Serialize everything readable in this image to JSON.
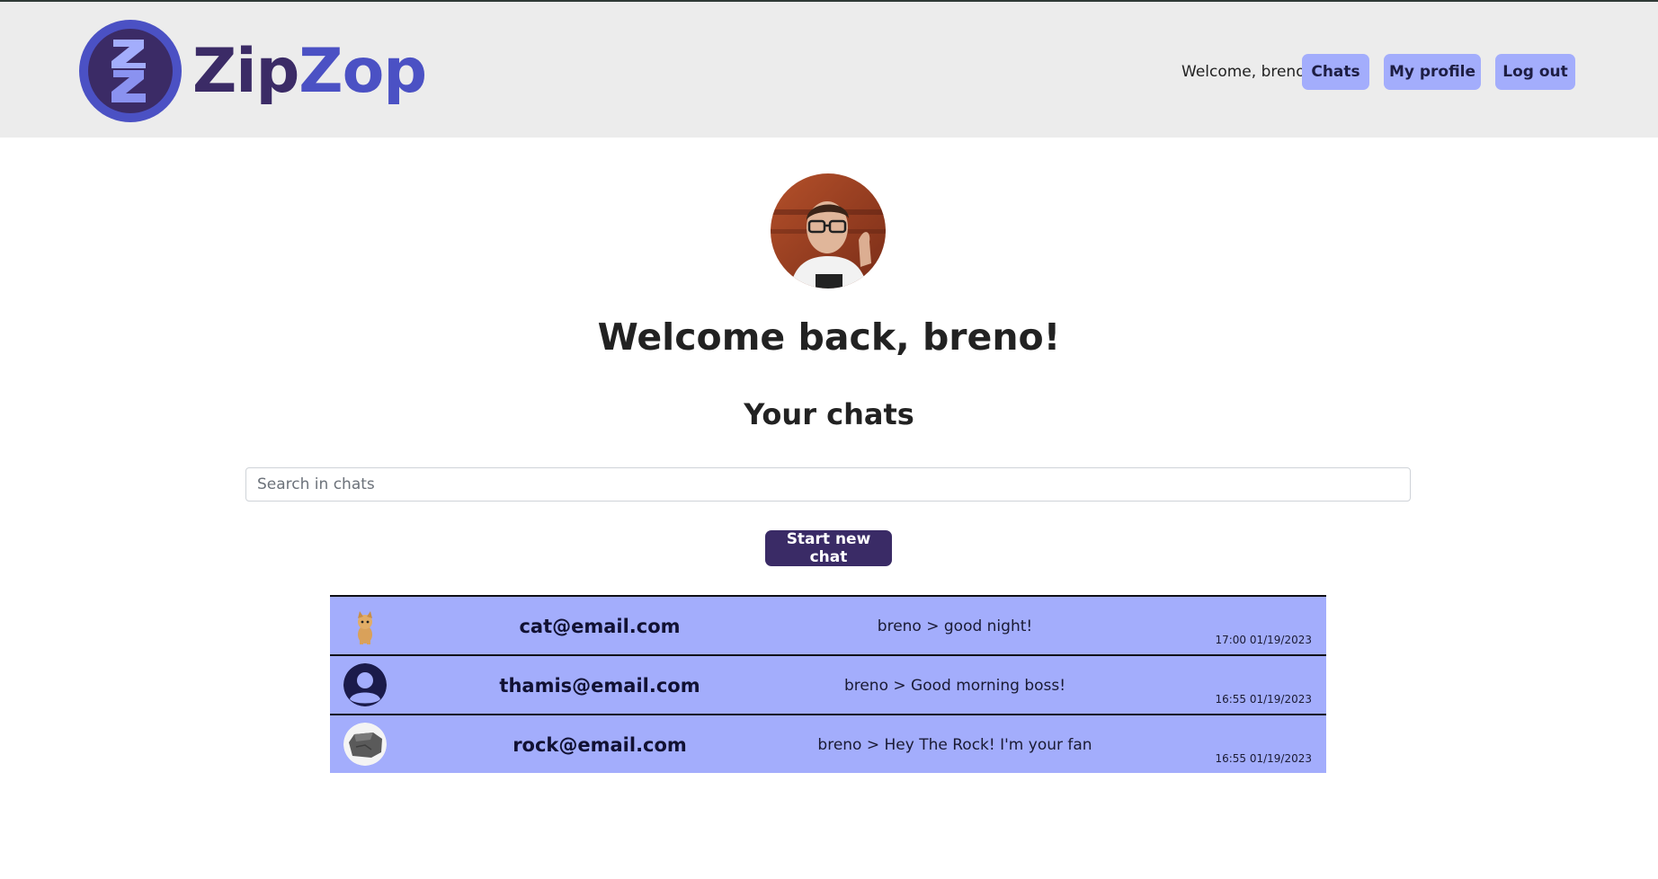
{
  "header": {
    "brand_part1": "Zip",
    "brand_part2": "Zop",
    "welcome_text": "Welcome, breno",
    "nav": {
      "chats": "Chats",
      "my_profile": "My profile",
      "log_out": "Log out"
    }
  },
  "main": {
    "welcome_heading": "Welcome back, breno!",
    "chats_heading": "Your chats",
    "search_placeholder": "Search in chats",
    "search_value": "",
    "new_chat_button": "Start new chat"
  },
  "chats": [
    {
      "avatar": "cat-photo",
      "email": "cat@email.com",
      "last_message": "breno > good night!",
      "time": "17:00 01/19/2023"
    },
    {
      "avatar": "default-user-icon",
      "email": "thamis@email.com",
      "last_message": "breno > Good morning boss!",
      "time": "16:55 01/19/2023"
    },
    {
      "avatar": "rock-photo",
      "email": "rock@email.com",
      "last_message": "breno > Hey The Rock! I'm your fan",
      "time": "16:55 01/19/2023"
    }
  ],
  "colors": {
    "header_bg": "#ececec",
    "nav_button": "#a3adfc",
    "brand_dark": "#3b2b66",
    "brand_accent": "#4b51c4",
    "primary_button": "#3a2b66",
    "chat_row_bg": "#a3adfc"
  }
}
